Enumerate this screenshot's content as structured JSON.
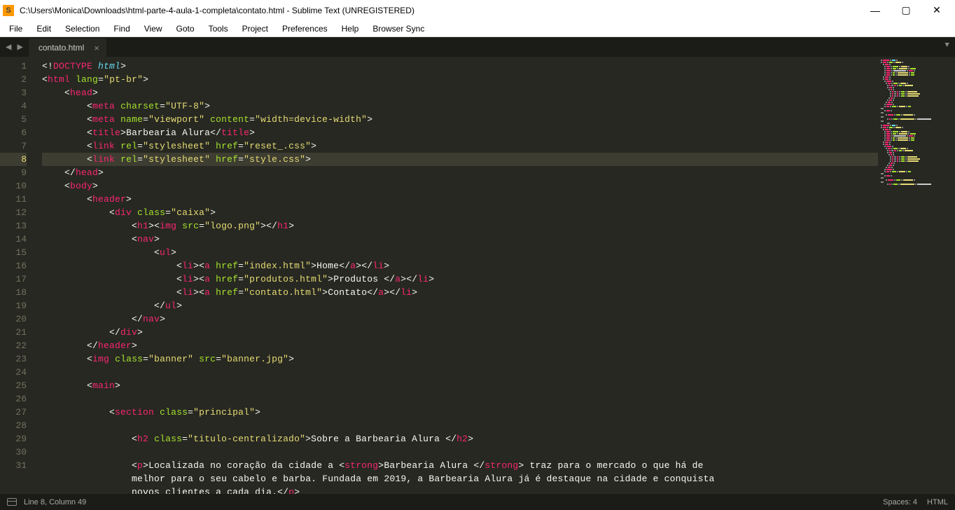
{
  "window": {
    "title": "C:\\Users\\Monica\\Downloads\\html-parte-4-aula-1-completa\\contato.html - Sublime Text (UNREGISTERED)",
    "app_icon_letter": "S"
  },
  "menu": [
    "File",
    "Edit",
    "Selection",
    "Find",
    "View",
    "Goto",
    "Tools",
    "Project",
    "Preferences",
    "Help",
    "Browser Sync"
  ],
  "tab": {
    "name": "contato.html"
  },
  "status": {
    "position": "Line 8, Column 49",
    "spaces": "Spaces: 4",
    "syntax": "HTML"
  },
  "code_lines": [
    {
      "n": 1,
      "i": 0,
      "tokens": [
        [
          "p",
          "<!"
        ],
        [
          "t",
          "DOCTYPE"
        ],
        [
          "p",
          " "
        ],
        [
          "kw",
          "html"
        ],
        [
          "p",
          ">"
        ]
      ]
    },
    {
      "n": 2,
      "i": 0,
      "tokens": [
        [
          "p",
          "<"
        ],
        [
          "t",
          "html"
        ],
        [
          "p",
          " "
        ],
        [
          "a",
          "lang"
        ],
        [
          "p",
          "="
        ],
        [
          "s",
          "\"pt-br\""
        ],
        [
          "p",
          ">"
        ]
      ]
    },
    {
      "n": 3,
      "i": 1,
      "tokens": [
        [
          "p",
          "<"
        ],
        [
          "t",
          "head"
        ],
        [
          "p",
          ">"
        ]
      ]
    },
    {
      "n": 4,
      "i": 2,
      "tokens": [
        [
          "p",
          "<"
        ],
        [
          "t",
          "meta"
        ],
        [
          "p",
          " "
        ],
        [
          "a",
          "charset"
        ],
        [
          "p",
          "="
        ],
        [
          "s",
          "\"UTF-8\""
        ],
        [
          "p",
          ">"
        ]
      ]
    },
    {
      "n": 5,
      "i": 2,
      "tokens": [
        [
          "p",
          "<"
        ],
        [
          "t",
          "meta"
        ],
        [
          "p",
          " "
        ],
        [
          "a",
          "name"
        ],
        [
          "p",
          "="
        ],
        [
          "s",
          "\"viewport\""
        ],
        [
          "p",
          " "
        ],
        [
          "a",
          "content"
        ],
        [
          "p",
          "="
        ],
        [
          "s",
          "\"width=device-width\""
        ],
        [
          "p",
          ">"
        ]
      ]
    },
    {
      "n": 6,
      "i": 2,
      "tokens": [
        [
          "p",
          "<"
        ],
        [
          "t",
          "title"
        ],
        [
          "p",
          ">"
        ],
        [
          "tx",
          "Barbearia Alura"
        ],
        [
          "p",
          "</"
        ],
        [
          "t",
          "title"
        ],
        [
          "p",
          ">"
        ]
      ]
    },
    {
      "n": 7,
      "i": 2,
      "tokens": [
        [
          "p",
          "<"
        ],
        [
          "t",
          "link"
        ],
        [
          "p",
          " "
        ],
        [
          "a",
          "rel"
        ],
        [
          "p",
          "="
        ],
        [
          "s",
          "\"stylesheet\""
        ],
        [
          "p",
          " "
        ],
        [
          "a",
          "href"
        ],
        [
          "p",
          "="
        ],
        [
          "s",
          "\"reset_.css\""
        ],
        [
          "p",
          ">"
        ]
      ]
    },
    {
      "n": 8,
      "i": 2,
      "current": true,
      "tokens": [
        [
          "p",
          "<"
        ],
        [
          "t",
          "link"
        ],
        [
          "p",
          " "
        ],
        [
          "a",
          "rel"
        ],
        [
          "p",
          "="
        ],
        [
          "s",
          "\"stylesheet\""
        ],
        [
          "p",
          " "
        ],
        [
          "a",
          "href"
        ],
        [
          "p",
          "="
        ],
        [
          "s",
          "\"style.css\""
        ],
        [
          "p",
          ">"
        ]
      ]
    },
    {
      "n": 9,
      "i": 1,
      "tokens": [
        [
          "p",
          "</"
        ],
        [
          "t",
          "head"
        ],
        [
          "p",
          ">"
        ]
      ]
    },
    {
      "n": 10,
      "i": 1,
      "tokens": [
        [
          "p",
          "<"
        ],
        [
          "t",
          "body"
        ],
        [
          "p",
          ">"
        ]
      ]
    },
    {
      "n": 11,
      "i": 2,
      "tokens": [
        [
          "p",
          "<"
        ],
        [
          "t",
          "header"
        ],
        [
          "p",
          ">"
        ]
      ]
    },
    {
      "n": 12,
      "i": 3,
      "tokens": [
        [
          "p",
          "<"
        ],
        [
          "t",
          "div"
        ],
        [
          "p",
          " "
        ],
        [
          "a",
          "class"
        ],
        [
          "p",
          "="
        ],
        [
          "s",
          "\"caixa\""
        ],
        [
          "p",
          ">"
        ]
      ]
    },
    {
      "n": 13,
      "i": 4,
      "tokens": [
        [
          "p",
          "<"
        ],
        [
          "t",
          "h1"
        ],
        [
          "p",
          "><"
        ],
        [
          "t",
          "img"
        ],
        [
          "p",
          " "
        ],
        [
          "a",
          "src"
        ],
        [
          "p",
          "="
        ],
        [
          "s",
          "\"logo.png\""
        ],
        [
          "p",
          "></"
        ],
        [
          "t",
          "h1"
        ],
        [
          "p",
          ">"
        ]
      ]
    },
    {
      "n": 14,
      "i": 4,
      "tokens": [
        [
          "p",
          "<"
        ],
        [
          "t",
          "nav"
        ],
        [
          "p",
          ">"
        ]
      ]
    },
    {
      "n": 15,
      "i": 5,
      "tokens": [
        [
          "p",
          "<"
        ],
        [
          "t",
          "ul"
        ],
        [
          "p",
          ">"
        ]
      ]
    },
    {
      "n": 16,
      "i": 6,
      "tokens": [
        [
          "p",
          "<"
        ],
        [
          "t",
          "li"
        ],
        [
          "p",
          "><"
        ],
        [
          "t",
          "a"
        ],
        [
          "p",
          " "
        ],
        [
          "a",
          "href"
        ],
        [
          "p",
          "="
        ],
        [
          "s",
          "\"index.html\""
        ],
        [
          "p",
          ">"
        ],
        [
          "tx",
          "Home"
        ],
        [
          "p",
          "</"
        ],
        [
          "t",
          "a"
        ],
        [
          "p",
          "></"
        ],
        [
          "t",
          "li"
        ],
        [
          "p",
          ">"
        ]
      ]
    },
    {
      "n": 17,
      "i": 6,
      "tokens": [
        [
          "p",
          "<"
        ],
        [
          "t",
          "li"
        ],
        [
          "p",
          "><"
        ],
        [
          "t",
          "a"
        ],
        [
          "p",
          " "
        ],
        [
          "a",
          "href"
        ],
        [
          "p",
          "="
        ],
        [
          "s",
          "\"produtos.html\""
        ],
        [
          "p",
          ">"
        ],
        [
          "tx",
          "Produtos "
        ],
        [
          "p",
          "</"
        ],
        [
          "t",
          "a"
        ],
        [
          "p",
          "></"
        ],
        [
          "t",
          "li"
        ],
        [
          "p",
          ">"
        ]
      ]
    },
    {
      "n": 18,
      "i": 6,
      "tokens": [
        [
          "p",
          "<"
        ],
        [
          "t",
          "li"
        ],
        [
          "p",
          "><"
        ],
        [
          "t",
          "a"
        ],
        [
          "p",
          " "
        ],
        [
          "a",
          "href"
        ],
        [
          "p",
          "="
        ],
        [
          "s",
          "\"contato.html\""
        ],
        [
          "p",
          ">"
        ],
        [
          "tx",
          "Contato"
        ],
        [
          "p",
          "</"
        ],
        [
          "t",
          "a"
        ],
        [
          "p",
          "></"
        ],
        [
          "t",
          "li"
        ],
        [
          "p",
          ">"
        ]
      ]
    },
    {
      "n": 19,
      "i": 5,
      "tokens": [
        [
          "p",
          "</"
        ],
        [
          "t",
          "ul"
        ],
        [
          "p",
          ">"
        ]
      ]
    },
    {
      "n": 20,
      "i": 4,
      "tokens": [
        [
          "p",
          "</"
        ],
        [
          "t",
          "nav"
        ],
        [
          "p",
          ">"
        ]
      ]
    },
    {
      "n": 21,
      "i": 3,
      "tokens": [
        [
          "p",
          "</"
        ],
        [
          "t",
          "div"
        ],
        [
          "p",
          ">"
        ]
      ]
    },
    {
      "n": 22,
      "i": 2,
      "tokens": [
        [
          "p",
          "</"
        ],
        [
          "t",
          "header"
        ],
        [
          "p",
          ">"
        ]
      ]
    },
    {
      "n": 23,
      "i": 2,
      "tokens": [
        [
          "p",
          "<"
        ],
        [
          "t",
          "img"
        ],
        [
          "p",
          " "
        ],
        [
          "a",
          "class"
        ],
        [
          "p",
          "="
        ],
        [
          "s",
          "\"banner\""
        ],
        [
          "p",
          " "
        ],
        [
          "a",
          "src"
        ],
        [
          "p",
          "="
        ],
        [
          "s",
          "\"banner.jpg\""
        ],
        [
          "p",
          ">"
        ]
      ]
    },
    {
      "n": 24,
      "i": 0,
      "tokens": []
    },
    {
      "n": 25,
      "i": 2,
      "tokens": [
        [
          "p",
          "<"
        ],
        [
          "t",
          "main"
        ],
        [
          "p",
          ">"
        ]
      ]
    },
    {
      "n": 26,
      "i": 0,
      "tokens": []
    },
    {
      "n": 27,
      "i": 3,
      "tokens": [
        [
          "p",
          "<"
        ],
        [
          "t",
          "section"
        ],
        [
          "p",
          " "
        ],
        [
          "a",
          "class"
        ],
        [
          "p",
          "="
        ],
        [
          "s",
          "\"principal\""
        ],
        [
          "p",
          ">"
        ]
      ]
    },
    {
      "n": 28,
      "i": 0,
      "tokens": []
    },
    {
      "n": 29,
      "i": 4,
      "tokens": [
        [
          "p",
          "<"
        ],
        [
          "t",
          "h2"
        ],
        [
          "p",
          " "
        ],
        [
          "a",
          "class"
        ],
        [
          "p",
          "="
        ],
        [
          "s",
          "\"titulo-centralizado\""
        ],
        [
          "p",
          ">"
        ],
        [
          "tx",
          "Sobre a Barbearia Alura "
        ],
        [
          "p",
          "</"
        ],
        [
          "t",
          "h2"
        ],
        [
          "p",
          ">"
        ]
      ]
    },
    {
      "n": 30,
      "i": 0,
      "tokens": []
    },
    {
      "n": 31,
      "i": 4,
      "plain": "<p>Localizada no coração da cidade a <strong>Barbearia Alura </strong> traz para o mercado o que há de melhor para o seu cabelo e barba. Fundada em 2019, a Barbearia Alura já é destaque na cidade e conquista novos clientes a cada dia.</p>",
      "wrap_indent": 4
    }
  ]
}
